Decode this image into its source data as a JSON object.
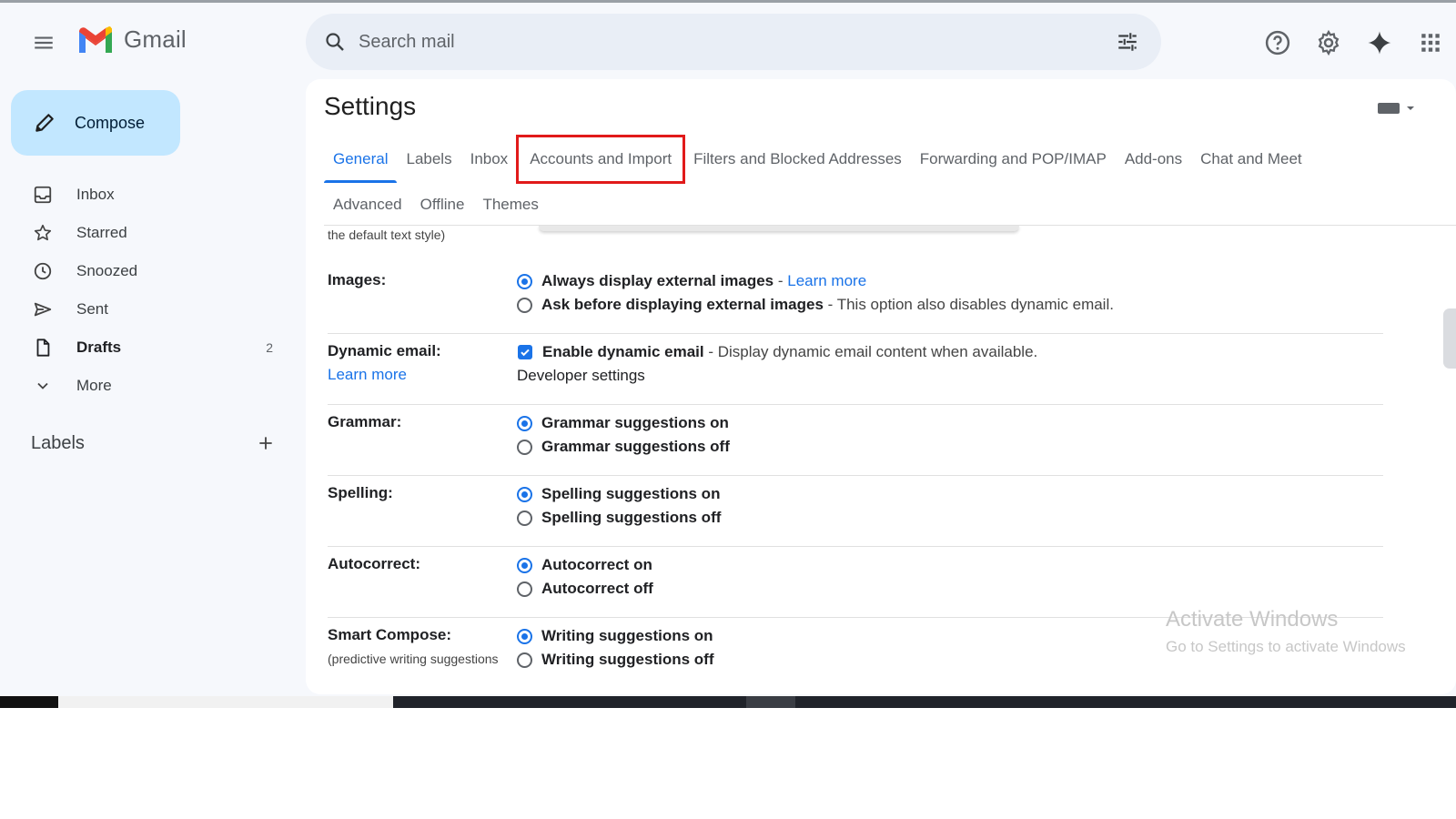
{
  "app": {
    "logo_text": "Gmail",
    "colors": {
      "accent": "#1a73e8",
      "compose_bg": "#c2e7ff",
      "highlight_box": "#e11a1a",
      "app_bg": "#f6f8fc"
    }
  },
  "header": {
    "search_placeholder": "Search mail",
    "icons": [
      "menu-icon",
      "search-icon",
      "tune-icon",
      "help-icon",
      "gear-icon",
      "sparkle-icon",
      "apps-grid-icon"
    ]
  },
  "sidebar": {
    "compose_label": "Compose",
    "items": [
      {
        "label": "Inbox",
        "icon": "inbox-icon",
        "count": ""
      },
      {
        "label": "Starred",
        "icon": "star-icon",
        "count": ""
      },
      {
        "label": "Snoozed",
        "icon": "clock-icon",
        "count": ""
      },
      {
        "label": "Sent",
        "icon": "send-icon",
        "count": ""
      },
      {
        "label": "Drafts",
        "icon": "draft-icon",
        "count": "2"
      },
      {
        "label": "More",
        "icon": "chevron-down-icon",
        "count": ""
      }
    ],
    "labels_title": "Labels"
  },
  "settings": {
    "title": "Settings",
    "tabs_row1": [
      "General",
      "Labels",
      "Inbox",
      "Accounts and Import",
      "Filters and Blocked Addresses",
      "Forwarding and POP/IMAP",
      "Add-ons",
      "Chat and Meet"
    ],
    "tabs_row2": [
      "Advanced",
      "Offline",
      "Themes"
    ],
    "active_tab": "General",
    "highlighted_tab": "Accounts and Import",
    "cut_off_text": "the default text style)",
    "images": {
      "label": "Images:",
      "opt1_bold": "Always display external images",
      "opt1_sep": " - ",
      "opt1_link": "Learn more",
      "opt2_bold": "Ask before displaying external images",
      "opt2_desc": " - This option also disables dynamic email.",
      "selected": "opt1"
    },
    "dynamic_email": {
      "label": "Dynamic email:",
      "learn_more": "Learn more",
      "checkbox_bold": "Enable dynamic email",
      "checkbox_desc": " - Display dynamic email content when available.",
      "checked": true,
      "developer_link": "Developer settings"
    },
    "grammar": {
      "label": "Grammar:",
      "on": "Grammar suggestions on",
      "off": "Grammar suggestions off",
      "selected": "on"
    },
    "spelling": {
      "label": "Spelling:",
      "on": "Spelling suggestions on",
      "off": "Spelling suggestions off",
      "selected": "on"
    },
    "autocorrect": {
      "label": "Autocorrect:",
      "on": "Autocorrect on",
      "off": "Autocorrect off",
      "selected": "on"
    },
    "smart_compose": {
      "label": "Smart Compose:",
      "sublabel": "(predictive writing suggestions",
      "on": "Writing suggestions on",
      "off": "Writing suggestions off",
      "selected": "on"
    }
  },
  "watermark": {
    "line1": "Activate Windows",
    "line2": "Go to Settings to activate Windows"
  }
}
